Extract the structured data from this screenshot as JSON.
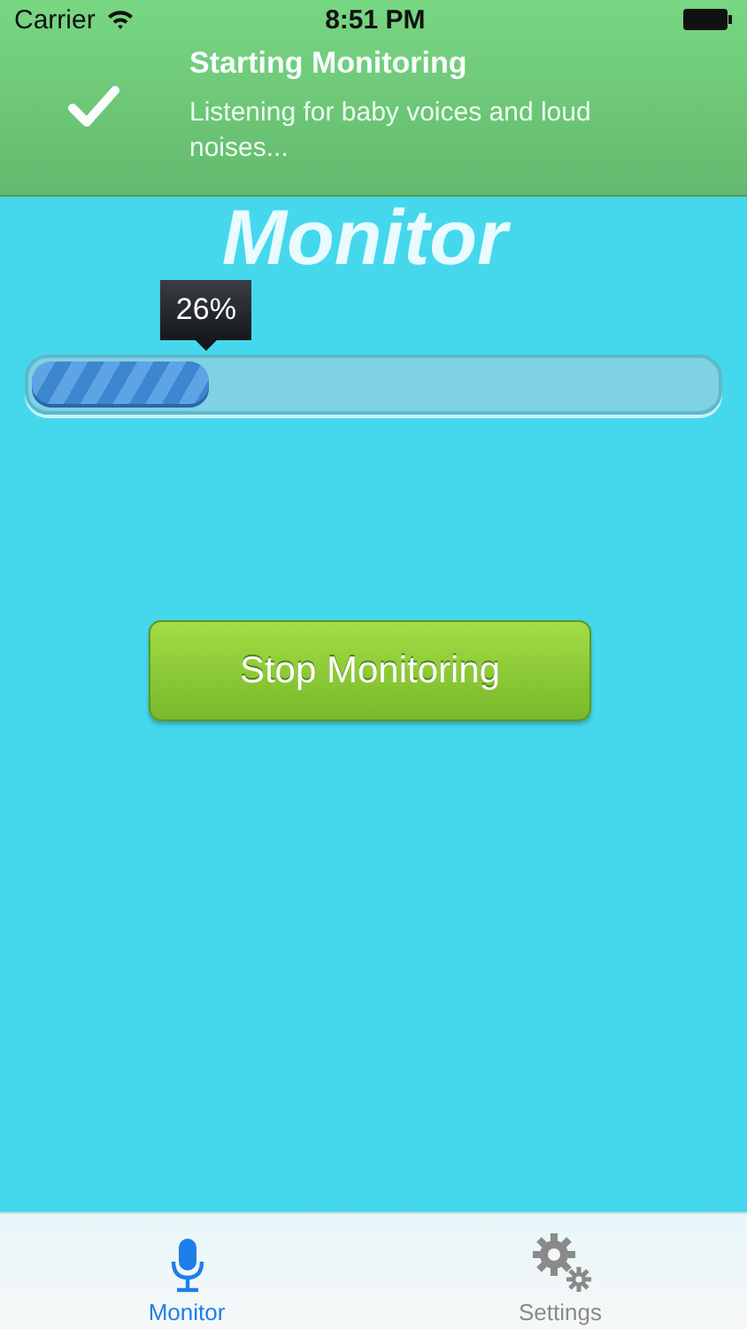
{
  "status_bar": {
    "carrier": "Carrier",
    "time": "8:51 PM"
  },
  "banner": {
    "title": "Starting Monitoring",
    "message": "Listening for baby voices and loud noises..."
  },
  "title": "Monitor",
  "progress": {
    "level": 0.26,
    "label": "26%"
  },
  "action_button": {
    "label": "Stop Monitoring"
  },
  "tabs": [
    {
      "label": "Monitor",
      "kind": "mic",
      "selected": true
    },
    {
      "label": "Settings",
      "kind": "gear",
      "selected": false
    }
  ]
}
